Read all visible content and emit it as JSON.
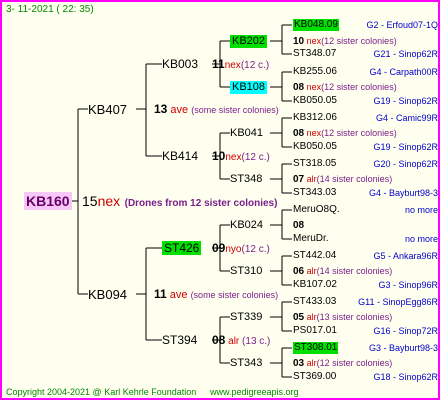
{
  "header": {
    "date": "3- 11-2021 ( 22: 35)"
  },
  "footer": {
    "copyright": "Copyright 2004-2021 @ Karl Kehrle Foundation",
    "url": "www.pedigreeapis.org"
  },
  "root": {
    "name": "KB160",
    "num": "15",
    "mark": "nex",
    "note": "(Drones from 12 sister colonies)"
  },
  "p1": {
    "name": "KB407",
    "num": "13",
    "mark": "ave",
    "note": "(some sister colonies)"
  },
  "p2": {
    "name": "KB094",
    "num": "11",
    "mark": "ave",
    "note": "(some sister colonies)"
  },
  "gp1": {
    "name": "KB003",
    "num": "11",
    "mark": "nex",
    "note": "(12 c.)"
  },
  "gp2": {
    "name": "KB414",
    "num": "10",
    "mark": "nex",
    "note": "(12 c.)"
  },
  "gp3": {
    "name": "ST426",
    "num": "09",
    "mark": "nyo",
    "note": "(12 c.)"
  },
  "gp4": {
    "name": "ST394",
    "num": "08",
    "mark": "alr",
    "note": "(13 c.)"
  },
  "ggp1": {
    "name": "KB202",
    "num": "10",
    "mark": "nex",
    "note": "(12 sister colonies)"
  },
  "ggp2": {
    "name": "KB108",
    "num": "08",
    "mark": "nex",
    "note": "(12 sister colonies)"
  },
  "ggp3": {
    "name": "KB041",
    "num": "08",
    "mark": "nex",
    "note": "(12 sister colonies)"
  },
  "ggp4": {
    "name": "ST348",
    "num": "07",
    "mark": "alr",
    "note": "(14 sister colonies)"
  },
  "ggp5": {
    "name": "KB024",
    "num": "08",
    "mark": "",
    "note": ""
  },
  "ggp6": {
    "name": "ST310",
    "num": "06",
    "mark": "alr",
    "note": "(14 sister colonies)"
  },
  "ggp7": {
    "name": "ST339",
    "num": "05",
    "mark": "alr",
    "note": "(13 sister colonies)"
  },
  "ggp8": {
    "name": "ST343",
    "num": "03",
    "mark": "alr",
    "note": "(12 sister colonies)"
  },
  "g4": [
    {
      "name": "KB048.09",
      "right": "G2 - Erfoud07-1Q"
    },
    {
      "name": "ST348.07",
      "right": "G21 - Sinop62R"
    },
    {
      "name": "KB255.06",
      "right": "G4 - Carpath00R"
    },
    {
      "name": "KB050.05",
      "right": "G19 - Sinop62R"
    },
    {
      "name": "KB312.06",
      "right": "G4 - Camic99R"
    },
    {
      "name": "KB050.05",
      "right": "G19 - Sinop62R"
    },
    {
      "name": "ST318.05",
      "right": "G20 - Sinop62R"
    },
    {
      "name": "ST343.03",
      "right": "G4 - Bayburt98-3"
    },
    {
      "name": "MeruO8Q.",
      "right": "no more"
    },
    {
      "name": "MeruDr.",
      "right": "no more"
    },
    {
      "name": "ST442.04",
      "right": "G5 - Ankara96R"
    },
    {
      "name": "KB107.02",
      "right": "G3 - Sinop96R"
    },
    {
      "name": "ST433.03",
      "right": "G11 - SinopEgg86R"
    },
    {
      "name": "PS017.01",
      "right": "G16 - Sinop72R"
    },
    {
      "name": "ST308.01",
      "right": "G3 - Bayburt98-3"
    },
    {
      "name": "ST369.00",
      "right": "G18 - Sinop62R"
    }
  ]
}
